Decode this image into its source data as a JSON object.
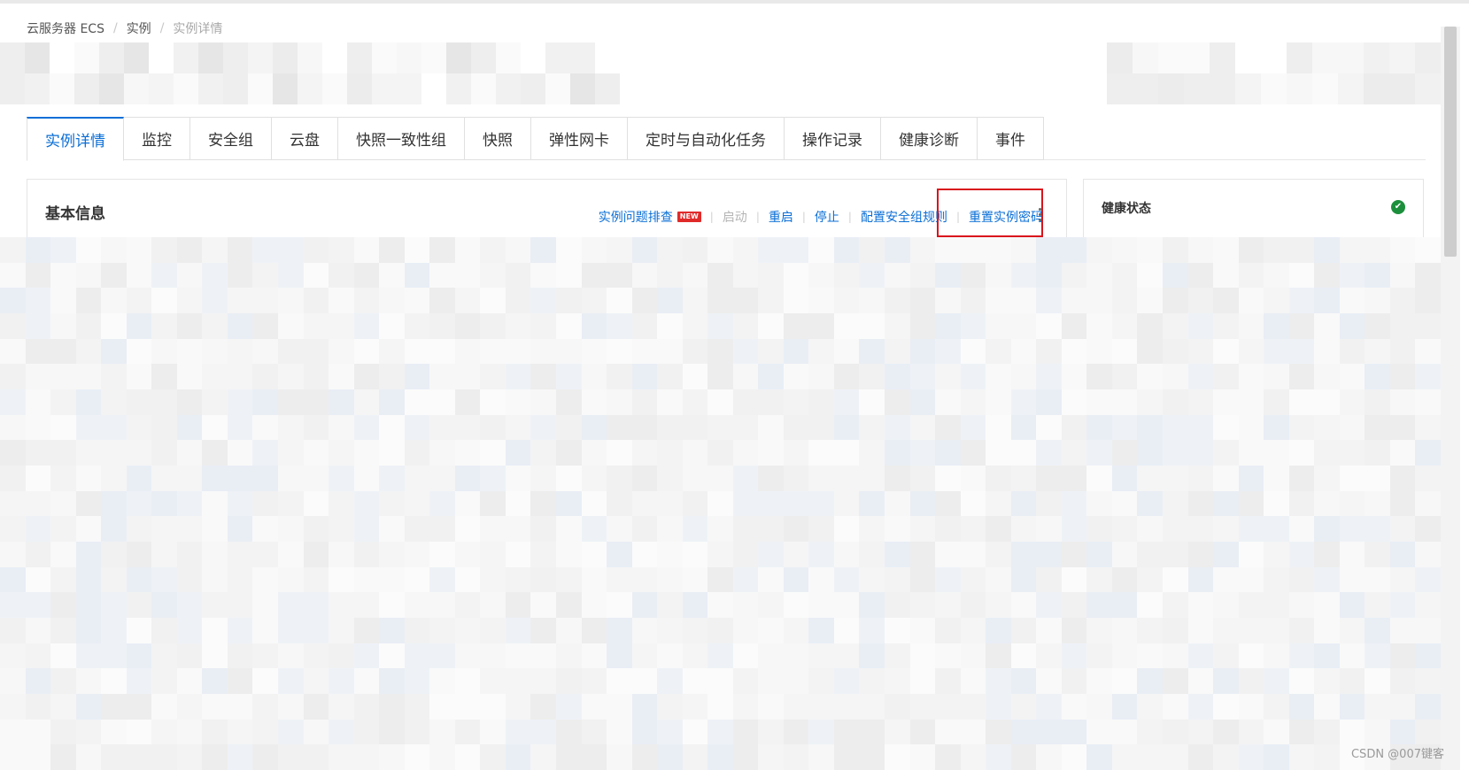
{
  "breadcrumb": {
    "items": [
      "云服务器 ECS",
      "实例"
    ],
    "current": "实例详情"
  },
  "tabs": [
    {
      "label": "实例详情",
      "active": true
    },
    {
      "label": "监控"
    },
    {
      "label": "安全组"
    },
    {
      "label": "云盘"
    },
    {
      "label": "快照一致性组"
    },
    {
      "label": "快照"
    },
    {
      "label": "弹性网卡"
    },
    {
      "label": "定时与自动化任务"
    },
    {
      "label": "操作记录"
    },
    {
      "label": "健康诊断"
    },
    {
      "label": "事件"
    }
  ],
  "basic_info": {
    "title": "基本信息",
    "actions": {
      "troubleshoot": "实例问题排查",
      "new_badge": "NEW",
      "start": "启动",
      "restart": "重启",
      "stop": "停止",
      "security_rules": "配置安全组规则",
      "reset_password": "重置实例密码"
    }
  },
  "health": {
    "title": "健康状态",
    "status_icon": "check-circle-icon",
    "status_color": "#1c8f3c"
  },
  "colors": {
    "accent": "#0b6fd6",
    "highlight_box": "#d9141c"
  },
  "watermark": "CSDN @007键客"
}
